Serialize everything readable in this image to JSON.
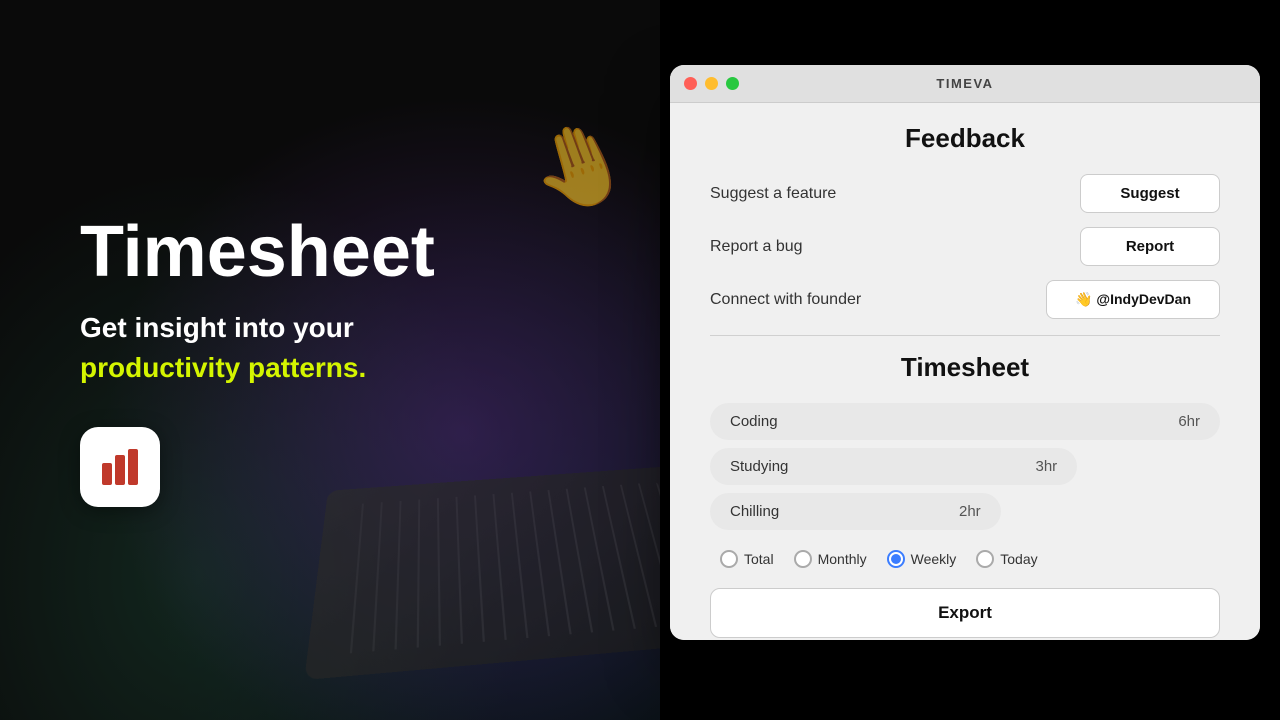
{
  "background": {
    "title": "Timesheet",
    "subtitle": "Get insight into your",
    "highlight": "productivity patterns."
  },
  "window": {
    "title": "TIMEVA",
    "dots": [
      "red",
      "yellow",
      "green"
    ],
    "feedback_section_title": "Feedback",
    "feedback_rows": [
      {
        "label": "Suggest a feature",
        "button_label": "Suggest"
      },
      {
        "label": "Report a bug",
        "button_label": "Report"
      },
      {
        "label": "Connect with founder",
        "button_label": "👋 @IndyDevDan"
      }
    ],
    "timesheet_section_title": "Timesheet",
    "timesheet_items": [
      {
        "name": "Coding",
        "time": "6hr"
      },
      {
        "name": "Studying",
        "time": "3hr"
      },
      {
        "name": "Chilling",
        "time": "2hr"
      }
    ],
    "radio_options": [
      {
        "label": "Total",
        "checked": false
      },
      {
        "label": "Monthly",
        "checked": false
      },
      {
        "label": "Weekly",
        "checked": true
      },
      {
        "label": "Today",
        "checked": false
      }
    ],
    "export_button_label": "Export"
  },
  "app_icon": {
    "aria": "bar-chart-icon"
  }
}
